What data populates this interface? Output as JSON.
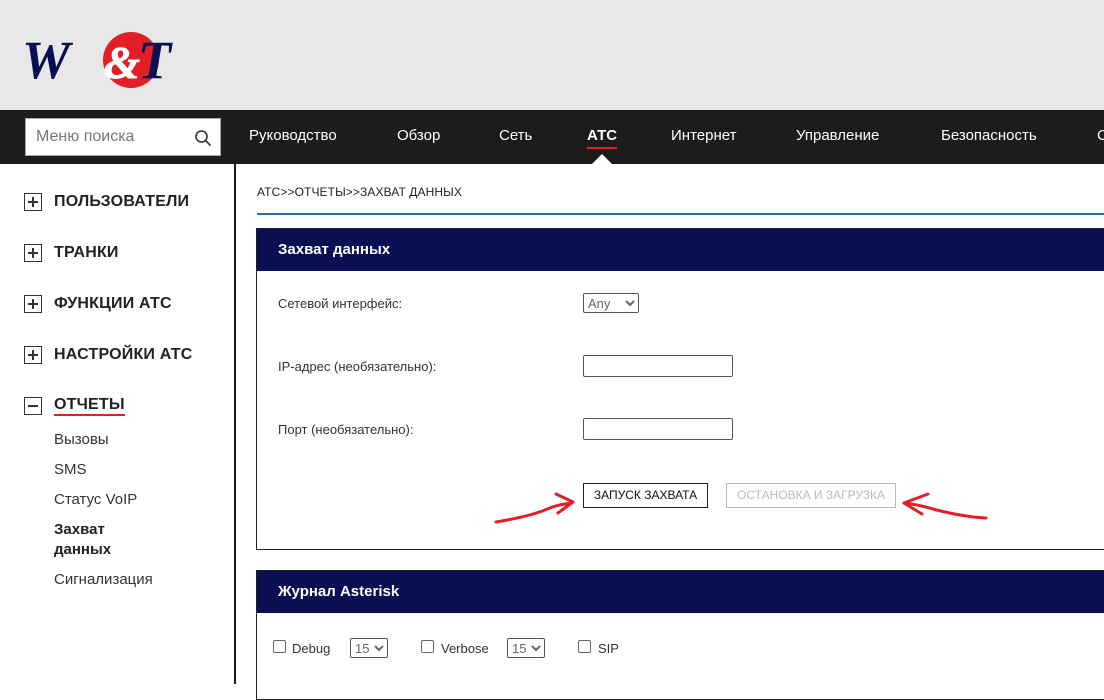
{
  "brand": {
    "logo_text": "W&T",
    "colors": {
      "navy": "#0a0e52",
      "red": "#e21e26"
    }
  },
  "search": {
    "placeholder": "Меню поиска",
    "icon": "search-icon"
  },
  "nav": {
    "items": [
      "Руководство",
      "Обзор",
      "Сеть",
      "АТС",
      "Интернет",
      "Управление",
      "Безопасность",
      "С"
    ],
    "active": "АТС"
  },
  "sidebar": {
    "groups": [
      {
        "label": "ПОЛЬЗОВАТЕЛИ",
        "state": "collapsed"
      },
      {
        "label": "ТРАНКИ",
        "state": "collapsed"
      },
      {
        "label": "ФУНКЦИИ АТС",
        "state": "collapsed"
      },
      {
        "label": "НАСТРОЙКИ АТС",
        "state": "collapsed"
      },
      {
        "label": "ОТЧЕТЫ",
        "state": "expanded"
      }
    ],
    "sub_items": [
      "Вызовы",
      "SMS",
      "Статус VoIP",
      "Захват данных",
      "Сигнализация"
    ],
    "active_sub": "Захват данных"
  },
  "breadcrumb": "АТС>>ОТЧЕТЫ>>ЗАХВАТ ДАННЫХ",
  "capture": {
    "title": "Захват данных",
    "interface_label": "Сетевой интерфейс:",
    "interface_value": "Any",
    "ip_label": "IP-адрес (необязательно):",
    "ip_value": "",
    "port_label": "Порт (необязательно):",
    "port_value": "",
    "start_button": "ЗАПУСК ЗАХВАТА",
    "stop_button": "ОСТАНОВКА И ЗАГРУЗКА"
  },
  "asterisk": {
    "title": "Журнал Asterisk",
    "debug_label": "Debug",
    "debug_level": "15",
    "verbose_label": "Verbose",
    "verbose_level": "15",
    "sip_label": "SIP"
  }
}
